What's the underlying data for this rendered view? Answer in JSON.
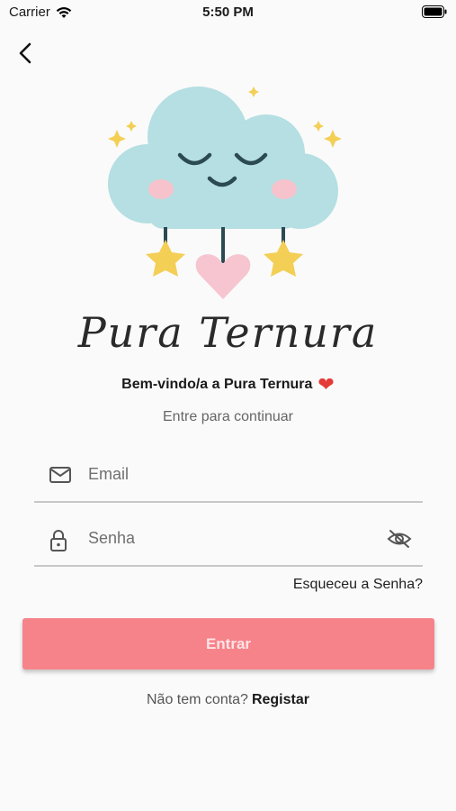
{
  "status_bar": {
    "carrier": "Carrier",
    "time": "5:50 PM",
    "wifi_icon": "wifi-icon",
    "battery_icon": "battery-icon"
  },
  "nav": {
    "back_icon": "chevron-left-icon"
  },
  "brand": {
    "title": "Pura Ternura",
    "logo": "cloud-with-stars-and-heart"
  },
  "welcome": {
    "text": "Bem-vindo/a a Pura Ternura",
    "emoji": "❤"
  },
  "subtitle": "Entre para continuar",
  "form": {
    "email": {
      "placeholder": "Email",
      "value": "",
      "icon": "mail-icon"
    },
    "password": {
      "placeholder": "Senha",
      "value": "",
      "icon": "lock-icon",
      "toggle_icon": "eye-off-icon"
    },
    "forgot_label": "Esqueceu a Senha?",
    "submit_label": "Entrar"
  },
  "signup": {
    "prompt": "Não tem conta?",
    "link_label": "Registar"
  },
  "colors": {
    "accent": "#f6838a",
    "button_text": "#fde3e5",
    "cloud": "#b5dfe2",
    "star": "#f3cf56",
    "heart": "#f6c5cf",
    "background": "#fafafa"
  }
}
